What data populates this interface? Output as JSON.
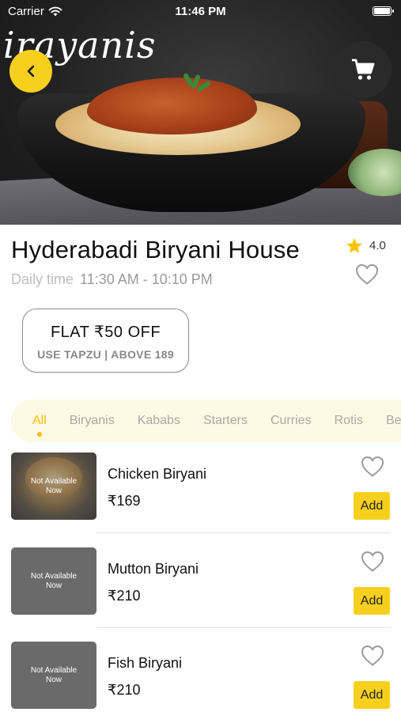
{
  "status_bar": {
    "carrier": "Carrier",
    "time": "11:46 PM"
  },
  "hero": {
    "brand_text": "irayanis"
  },
  "restaurant": {
    "name": "Hyderabadi Biryani House",
    "rating": "4.0",
    "hours_label": "Daily time",
    "hours_value": "11:30 AM - 10:10 PM"
  },
  "coupon": {
    "title": "FLAT ₹50 OFF",
    "subtitle": "USE TAPZU | ABOVE 189"
  },
  "tabs": [
    {
      "label": "All",
      "active": true
    },
    {
      "label": "Biryanis"
    },
    {
      "label": "Kababs"
    },
    {
      "label": "Starters"
    },
    {
      "label": "Curries"
    },
    {
      "label": "Rotis"
    },
    {
      "label": "Beverages"
    }
  ],
  "menu_items": [
    {
      "name": "Chicken Biryani",
      "price": "₹169",
      "status": "Not Available Now",
      "add_label": "Add",
      "has_photo": true
    },
    {
      "name": "Mutton Biryani",
      "price": "₹210",
      "status": "Not Available Now",
      "add_label": "Add",
      "has_photo": false
    },
    {
      "name": "Fish Biryani",
      "price": "₹210",
      "status": "Not Available Now",
      "add_label": "Add",
      "has_photo": false
    }
  ],
  "colors": {
    "accent": "#f7d01d",
    "active_tab": "#f2c200",
    "tab_bar_bg": "#fdf9e3"
  },
  "icons": {
    "back": "chevron-left-icon",
    "cart": "cart-icon",
    "favorite": "heart-outline-icon",
    "rating": "star-icon"
  }
}
